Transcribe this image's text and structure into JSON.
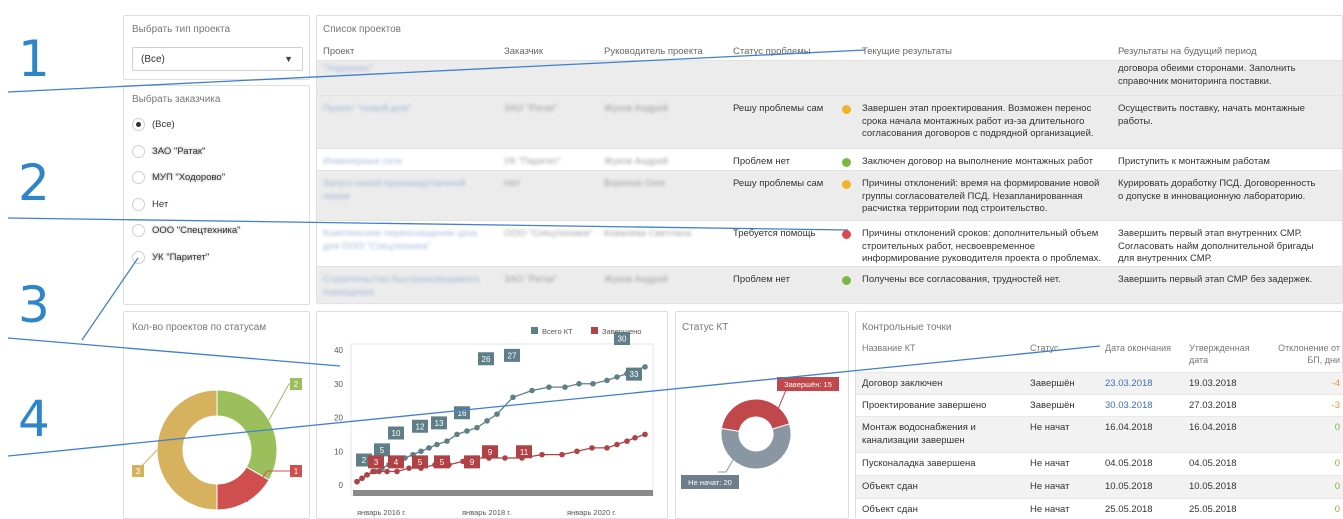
{
  "filters": {
    "project_type_title": "Выбрать тип проекта",
    "project_type_value": "(Все)",
    "customer_title": "Выбрать заказчика",
    "customers": [
      {
        "label": "(Все)",
        "selected": true,
        "blurred": false
      },
      {
        "label": "ЗАО \"Ратак\"",
        "selected": false,
        "blurred": true
      },
      {
        "label": "МУП \"Ходорово\"",
        "selected": false,
        "blurred": true
      },
      {
        "label": "Нет",
        "selected": false,
        "blurred": false
      },
      {
        "label": "ООО \"Спецтехника\"",
        "selected": false,
        "blurred": true
      },
      {
        "label": "УК \"Паритет\"",
        "selected": false,
        "blurred": true
      }
    ]
  },
  "project_list": {
    "title": "Список проектов",
    "headers": [
      "Проект",
      "Заказчик",
      "Руководитель проекта",
      "Статус проблемы",
      "Текущие результаты",
      "Результаты на будущий период"
    ],
    "rows": [
      {
        "project": "\"Ходорово\"",
        "customer": "",
        "manager": "",
        "status": "",
        "dot": "",
        "current": "",
        "future": "договора обеими сторонами. Заполнить справочник мониторинга поставки."
      },
      {
        "project": "Проект \"новый дом\"",
        "customer": "ЗАО \"Ратак\"",
        "manager": "Жуков Андрей",
        "status": "Решу проблемы сам",
        "dot": "#f0b429",
        "current": "Завершен этап проектирования. Возможен перенос срока начала монтажных работ из-за длительного согласования договоров с подрядной организацией.",
        "future": "Осуществить поставку, начать монтажные работы."
      },
      {
        "project": "Инженерные сети",
        "customer": "УК \"Паритет\"",
        "manager": "Жуков Андрей",
        "status": "Проблем нет",
        "dot": "#7cb842",
        "current": "Заключен договор на выполнение монтажных работ",
        "future": "Приступить к монтажным работам"
      },
      {
        "project": "Запуск новой производственной линии",
        "customer": "Нет",
        "manager": "Воронов Олег",
        "status": "Решу проблемы сам",
        "dot": "#f0b429",
        "current": "Причины отклонений: время на формирование новой группы согласователей ПСД. Незапланированная расчистка территории под строительство.",
        "future": "Курировать доработку ПСД. Договоренность о допуске в инновационную лабораторию."
      },
      {
        "project": "Комплексное переоснащение цеха для ООО \"Спецтехника\"",
        "customer": "ООО \"Спецтехника\"",
        "manager": "Ковалева Светлана",
        "status": "Требуется помощь",
        "dot": "#e0474c",
        "current": "Причины отклонений сроков: дополнительный объем строительных работ, несвоевременное информирование руководителя проекта о проблемах.",
        "future": "Завершить первый этап внутренних СМР. Согласовать найм дополнительной бригады для внутренних СМР."
      },
      {
        "project": "Строительство быстровозводимого помещения",
        "customer": "ЗАО \"Ратак\"",
        "manager": "Жуков Андрей",
        "status": "Проблем нет",
        "dot": "#7cb842",
        "current": "Получены все согласования, трудностей нет.",
        "future": "Завершить первый этап СМР без задержек."
      }
    ]
  },
  "status_count": {
    "title": "Кол-во проектов по статусам",
    "slices": [
      {
        "label": "2",
        "value": 2,
        "color": "#9bc05b"
      },
      {
        "label": "1",
        "value": 1,
        "color": "#cf4f4f"
      },
      {
        "label": "3",
        "value": 3,
        "color": "#d6b15e"
      }
    ]
  },
  "kt_chart": {
    "legend_total": "Всего КТ",
    "legend_done": "Завершено",
    "color_total": "#5e7e88",
    "color_done": "#b04145",
    "y_ticks": [
      "40",
      "30",
      "20",
      "10",
      "0"
    ],
    "x_ticks": [
      "январь 2016 г.",
      "январь 2018 г.",
      "январь 2020 г."
    ],
    "total_labels": [
      "2",
      "5",
      "10",
      "12",
      "13",
      "16",
      "26",
      "27",
      "30",
      "33"
    ],
    "done_labels": [
      "3",
      "4",
      "5",
      "5",
      "9",
      "9",
      "11"
    ]
  },
  "chart_data": [
    {
      "type": "line",
      "title": "",
      "ylim": [
        0,
        40
      ],
      "series": [
        {
          "name": "Всего КТ",
          "labels": [
            "2",
            "5",
            "10",
            "12",
            "13",
            "16",
            "26",
            "27",
            "30",
            "33"
          ]
        },
        {
          "name": "Завершено",
          "labels": [
            "3",
            "4",
            "5",
            "5",
            "9",
            "9",
            "11"
          ]
        }
      ]
    },
    {
      "type": "pie",
      "title": "Статус КТ",
      "slices": [
        {
          "label": "Завершён: 15",
          "value": 15
        },
        {
          "label": "Не начат: 20",
          "value": 20
        }
      ]
    }
  ],
  "kt_status": {
    "title": "Статус КТ",
    "done_label": "Завершён: 15",
    "not_started_label": "Не начат: 20",
    "done_value": 15,
    "not_started_value": 20
  },
  "checkpoints": {
    "title": "Контрольные точки",
    "headers": [
      "Название КТ",
      "Статус",
      "Дата окончания",
      "Утвержденная дата",
      "Отклонение от БП, дни"
    ],
    "rows": [
      {
        "name": "Договор заключен",
        "status": "Завершён",
        "end": "23.03.2018",
        "approved": "19.03.2018",
        "dev": "-4",
        "dev_color": "#e8963c",
        "end_link": true
      },
      {
        "name": "Проектирование завершено",
        "status": "Завершён",
        "end": "30.03.2018",
        "approved": "27.03.2018",
        "dev": "-3",
        "dev_color": "#e8963c",
        "end_link": true
      },
      {
        "name": "Монтаж водоснабжения и канализации завершен",
        "status": "Не начат",
        "end": "16.04.2018",
        "approved": "16.04.2018",
        "dev": "0",
        "dev_color": "#7cb842",
        "end_link": false
      },
      {
        "name": "Пусконаладка завершена",
        "status": "Не начат",
        "end": "04.05.2018",
        "approved": "04.05.2018",
        "dev": "0",
        "dev_color": "#7cb842",
        "end_link": false
      },
      {
        "name": "Объект сдан",
        "status": "Не начат",
        "end": "10.05.2018",
        "approved": "10.05.2018",
        "dev": "0",
        "dev_color": "#7cb842",
        "end_link": false
      },
      {
        "name": "Объект сдан",
        "status": "Не начат",
        "end": "25.05.2018",
        "approved": "25.05.2018",
        "dev": "0",
        "dev_color": "#7cb842",
        "end_link": false
      }
    ]
  },
  "annotations": [
    "1",
    "2",
    "3",
    "4"
  ]
}
